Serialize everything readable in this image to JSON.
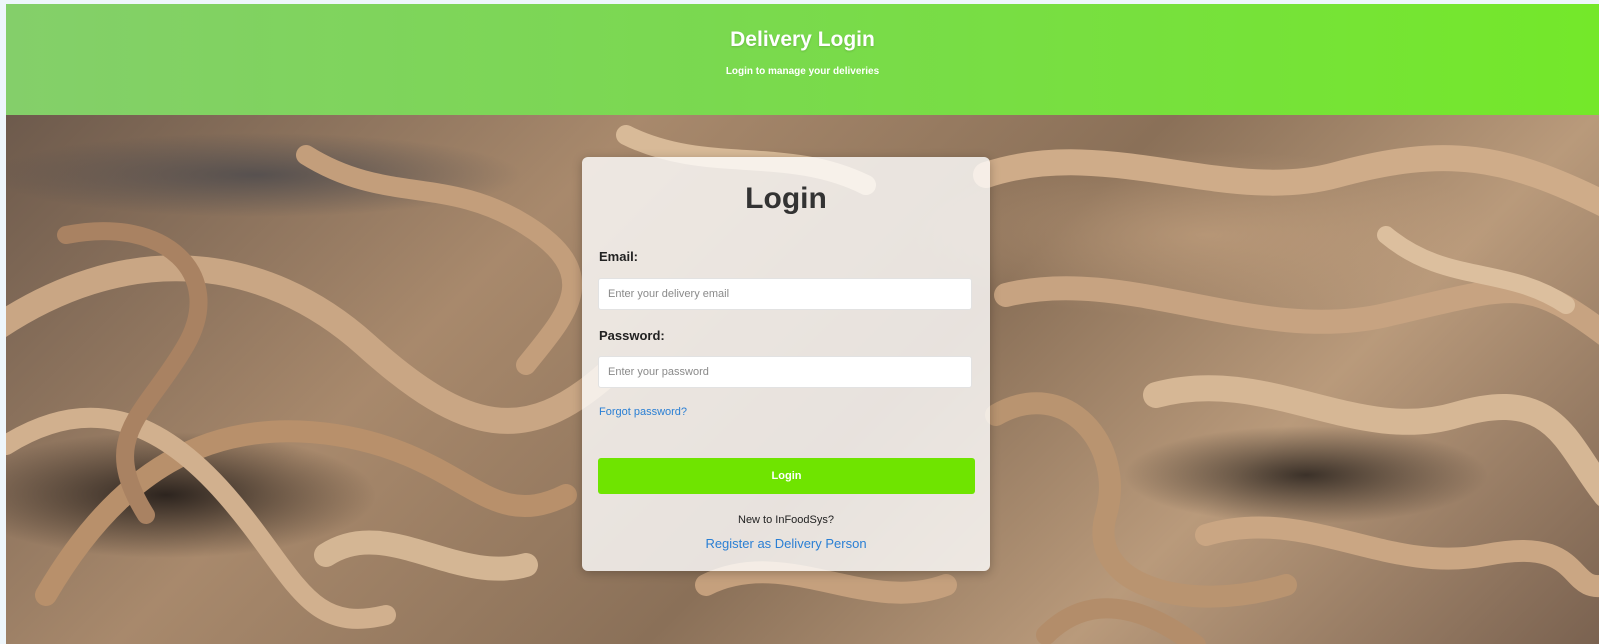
{
  "header": {
    "title": "Delivery Login",
    "subtitle": "Login to manage your deliveries"
  },
  "login_card": {
    "title": "Login",
    "email_label": "Email:",
    "email_placeholder": "Enter your delivery email",
    "email_value": "",
    "password_label": "Password:",
    "password_placeholder": "Enter your password",
    "password_value": "",
    "forgot_link": "Forgot password?",
    "login_button": "Login",
    "new_user_text": "New to InFoodSys?",
    "register_link": "Register as Delivery Person"
  },
  "colors": {
    "header_gradient_start": "#84cf6a",
    "header_gradient_end": "#74e82a",
    "button": "#6fe400",
    "link": "#2a7fd4"
  },
  "background_image": "fresh-pasta-noodles-photo"
}
